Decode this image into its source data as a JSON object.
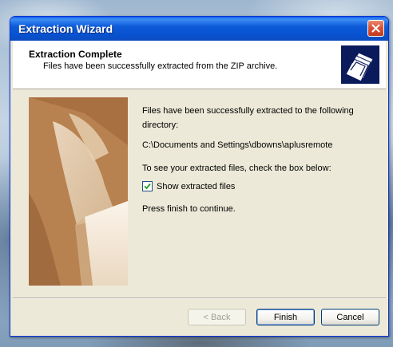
{
  "window": {
    "title": "Extraction Wizard"
  },
  "header": {
    "title": "Extraction Complete",
    "subtitle": "Files have been successfully extracted from the ZIP archive.",
    "icon": "folders-icon"
  },
  "body": {
    "intro": "Files have been successfully extracted to the following directory:",
    "path": "C:\\Documents and Settings\\dbowns\\aplusremote",
    "instruction": "To see your extracted files, check the box below:",
    "checkbox": {
      "label": "Show extracted files",
      "checked": true
    },
    "finish_text": "Press finish to continue."
  },
  "buttons": {
    "back": "< Back",
    "finish": "Finish",
    "cancel": "Cancel"
  },
  "colors": {
    "titlebar": "#0852d0",
    "close_button": "#d9553a",
    "dialog_background": "#ece9d8"
  }
}
